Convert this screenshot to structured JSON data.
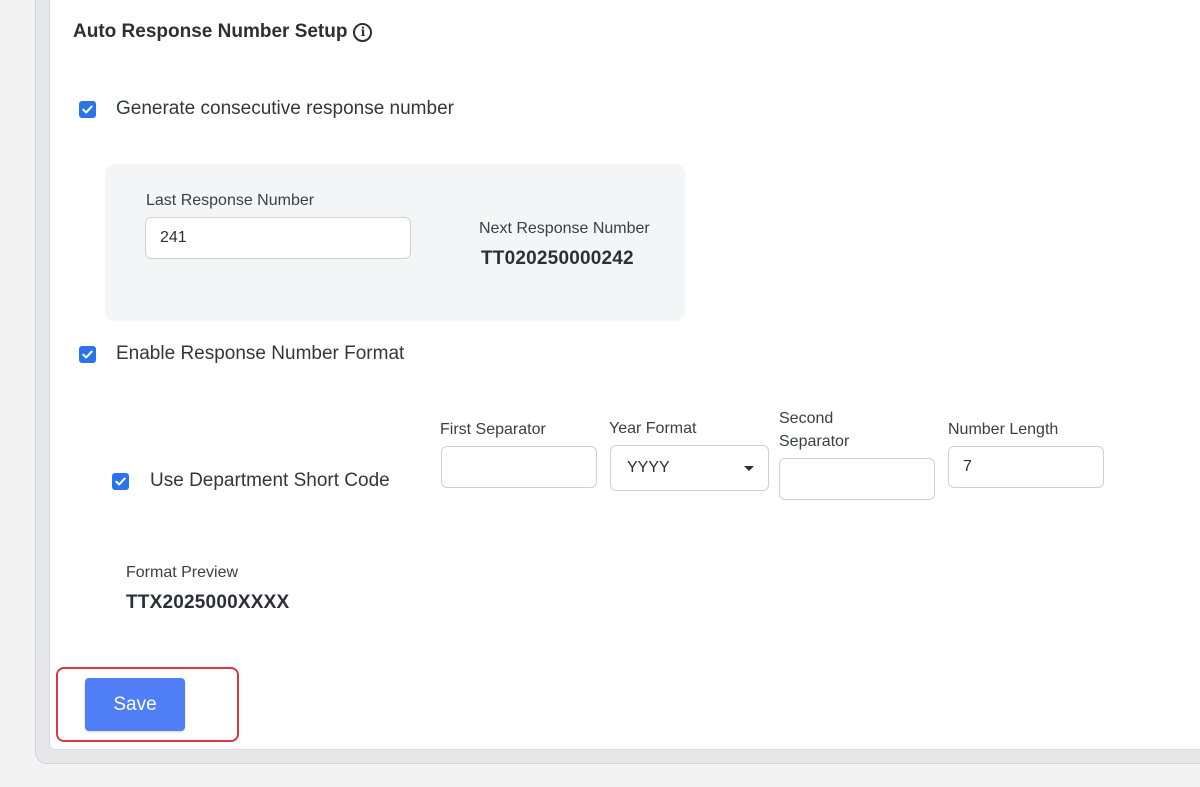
{
  "section": {
    "title": "Auto Response Number Setup",
    "info_icon": "info-circle-icon"
  },
  "consecutive": {
    "label": "Generate consecutive response number",
    "checked": true
  },
  "last_response": {
    "label": "Last Response Number",
    "value": "241"
  },
  "next_response": {
    "label": "Next Response Number",
    "value": "TT020250000242"
  },
  "format_enable": {
    "label": "Enable Response Number Format",
    "checked": true
  },
  "department_code": {
    "label": "Use Department Short Code",
    "checked": true
  },
  "first_separator": {
    "label": "First Separator",
    "value": ""
  },
  "year_format": {
    "label": "Year Format",
    "selected": "YYYY"
  },
  "second_separator": {
    "label_line1": "Second",
    "label_line2": "Separator",
    "value": ""
  },
  "number_length": {
    "label": "Number Length",
    "value": "7"
  },
  "preview": {
    "label": "Format Preview",
    "value": "TTX2025000XXXX"
  },
  "actions": {
    "save_label": "Save"
  },
  "colors": {
    "accent": "#2a73e8",
    "save_button": "#4f7ef7",
    "highlight": "#d9363e"
  }
}
